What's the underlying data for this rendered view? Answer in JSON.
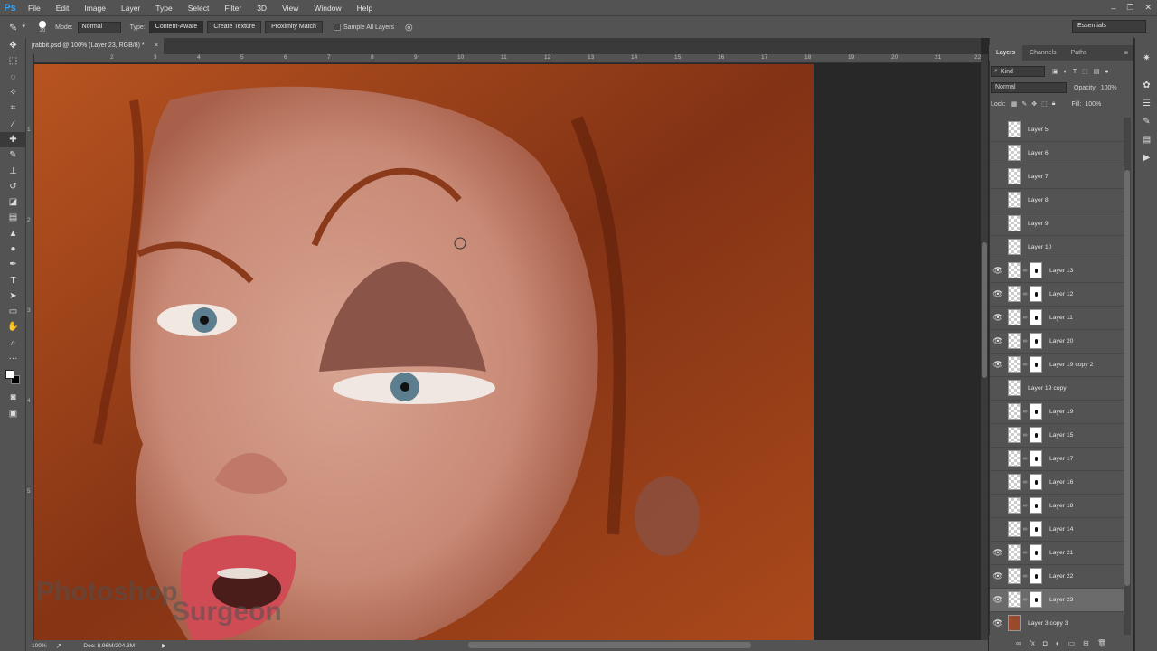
{
  "app": {
    "logo": "Ps"
  },
  "menu": [
    "File",
    "Edit",
    "Image",
    "Layer",
    "Type",
    "Select",
    "Filter",
    "3D",
    "View",
    "Window",
    "Help"
  ],
  "options_bar": {
    "brush_size": "20",
    "mode_label": "Mode:",
    "mode_value": "Normal",
    "type_label": "Type:",
    "type_buttons": [
      "Content-Aware",
      "Create Texture",
      "Proximity Match"
    ],
    "sample_all_layers": "Sample All Layers"
  },
  "workspace": "Essentials",
  "document": {
    "tab_title": "jrabbit.psd @ 100% (Layer 23, RGB/8) *",
    "close": "×"
  },
  "rulers": {
    "top": [
      "2",
      "3",
      "4",
      "5",
      "6",
      "7",
      "8",
      "9",
      "10",
      "11",
      "12",
      "13",
      "14",
      "15",
      "16",
      "17",
      "18",
      "19",
      "20",
      "21",
      "22"
    ],
    "left": [
      "1",
      "2",
      "3",
      "4",
      "5"
    ]
  },
  "status": {
    "zoom": "100%",
    "doc": "Doc: 8.96M/204.3M"
  },
  "watermark": {
    "line1": "Photoshop",
    "line2": "Surgeon"
  },
  "panel": {
    "tabs": [
      "Layers",
      "Channels",
      "Paths"
    ],
    "filter_label": "Kind",
    "blend_mode": "Normal",
    "opacity_label": "Opacity:",
    "opacity_value": "100%",
    "lock_label": "Lock:",
    "fill_label": "Fill:",
    "fill_value": "100%"
  },
  "layers": [
    {
      "name": "Layer 5",
      "visible": false,
      "mask": false
    },
    {
      "name": "Layer 6",
      "visible": false,
      "mask": false
    },
    {
      "name": "Layer 7",
      "visible": false,
      "mask": false
    },
    {
      "name": "Layer 8",
      "visible": false,
      "mask": false
    },
    {
      "name": "Layer 9",
      "visible": false,
      "mask": false
    },
    {
      "name": "Layer 10",
      "visible": false,
      "mask": false
    },
    {
      "name": "Layer 13",
      "visible": true,
      "mask": true
    },
    {
      "name": "Layer 12",
      "visible": true,
      "mask": true
    },
    {
      "name": "Layer 11",
      "visible": true,
      "mask": true
    },
    {
      "name": "Layer 20",
      "visible": true,
      "mask": true
    },
    {
      "name": "Layer 19 copy 2",
      "visible": true,
      "mask": true
    },
    {
      "name": "Layer 19 copy",
      "visible": false,
      "mask": false
    },
    {
      "name": "Layer 19",
      "visible": false,
      "mask": true
    },
    {
      "name": "Layer 15",
      "visible": false,
      "mask": true
    },
    {
      "name": "Layer 17",
      "visible": false,
      "mask": true
    },
    {
      "name": "Layer 16",
      "visible": false,
      "mask": true
    },
    {
      "name": "Layer 18",
      "visible": false,
      "mask": true
    },
    {
      "name": "Layer 14",
      "visible": false,
      "mask": true
    },
    {
      "name": "Layer 21",
      "visible": true,
      "mask": true
    },
    {
      "name": "Layer 22",
      "visible": true,
      "mask": true
    },
    {
      "name": "Layer 23",
      "visible": true,
      "mask": true,
      "selected": true
    },
    {
      "name": "Layer 3 copy 3",
      "visible": true,
      "mask": false,
      "photo": true
    }
  ]
}
